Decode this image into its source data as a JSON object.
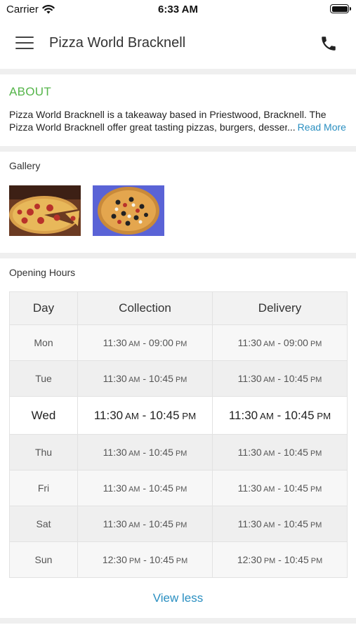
{
  "status_bar": {
    "carrier": "Carrier",
    "time": "6:33 AM"
  },
  "header": {
    "title": "Pizza World Bracknell",
    "menu_icon": "hamburger-menu-icon",
    "phone_icon": "phone-icon"
  },
  "about": {
    "heading": "ABOUT",
    "line1": "Pizza World Bracknell is a takeaway based in Priestwood, Bracknell. The",
    "line2": "Pizza World Bracknell offer great tasting pizzas, burgers, desserts",
    "ellipsis": "...",
    "read_more": "Read More"
  },
  "gallery": {
    "label": "Gallery"
  },
  "opening_hours": {
    "label": "Opening Hours",
    "headers": {
      "day": "Day",
      "collection": "Collection",
      "delivery": "Delivery"
    },
    "rows": [
      {
        "day": "Mon",
        "collection": {
          "start": "11:30",
          "start_period": "AM",
          "end": "09:00",
          "end_period": "PM"
        },
        "delivery": {
          "start": "11:30",
          "start_period": "AM",
          "end": "09:00",
          "end_period": "PM"
        }
      },
      {
        "day": "Tue",
        "collection": {
          "start": "11:30",
          "start_period": "AM",
          "end": "10:45",
          "end_period": "PM"
        },
        "delivery": {
          "start": "11:30",
          "start_period": "AM",
          "end": "10:45",
          "end_period": "PM"
        }
      },
      {
        "day": "Wed",
        "collection": {
          "start": "11:30",
          "start_period": "AM",
          "end": "10:45",
          "end_period": "PM"
        },
        "delivery": {
          "start": "11:30",
          "start_period": "AM",
          "end": "10:45",
          "end_period": "PM"
        }
      },
      {
        "day": "Thu",
        "collection": {
          "start": "11:30",
          "start_period": "AM",
          "end": "10:45",
          "end_period": "PM"
        },
        "delivery": {
          "start": "11:30",
          "start_period": "AM",
          "end": "10:45",
          "end_period": "PM"
        }
      },
      {
        "day": "Fri",
        "collection": {
          "start": "11:30",
          "start_period": "AM",
          "end": "10:45",
          "end_period": "PM"
        },
        "delivery": {
          "start": "11:30",
          "start_period": "AM",
          "end": "10:45",
          "end_period": "PM"
        }
      },
      {
        "day": "Sat",
        "collection": {
          "start": "11:30",
          "start_period": "AM",
          "end": "10:45",
          "end_period": "PM"
        },
        "delivery": {
          "start": "11:30",
          "start_period": "AM",
          "end": "10:45",
          "end_period": "PM"
        }
      },
      {
        "day": "Sun",
        "collection": {
          "start": "12:30",
          "start_period": "PM",
          "end": "10:45",
          "end_period": "PM"
        },
        "delivery": {
          "start": "12:30",
          "start_period": "PM",
          "end": "10:45",
          "end_period": "PM"
        }
      }
    ],
    "time_separator": " - "
  },
  "view_less": "View less",
  "colors": {
    "accent_green": "#55b54a",
    "link_blue": "#2a8fc1",
    "divider": "#efefef"
  }
}
